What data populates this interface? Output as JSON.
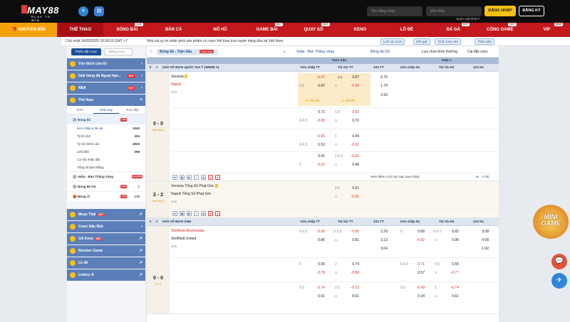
{
  "header": {
    "logo": "MAY88",
    "logo_sub": "PLAY TO WIN",
    "username_placeholder": "Tên đăng nhập",
    "password_placeholder": "Mật khẩu",
    "forgot": "Quên mật khẩu?",
    "login": "ĐĂNG NHẬP",
    "register": "ĐĂNG KÝ",
    "colors": {
      "nav": "#c3181d",
      "accent": "#f5c014",
      "blue": "#1c4f96"
    }
  },
  "nav": [
    {
      "label": "KHUYẾN MÃI",
      "badge": ""
    },
    {
      "label": "THỂ THAO",
      "badge": ""
    },
    {
      "label": "SÒNG BÀI",
      "badge": "LIVE"
    },
    {
      "label": "BẮN CÁ",
      "badge": ""
    },
    {
      "label": "NỔ HŨ",
      "badge": ""
    },
    {
      "label": "GAME BÀI",
      "badge": "HOT"
    },
    {
      "label": "QUAY SỐ",
      "badge": "HOT"
    },
    {
      "label": "KENO",
      "badge": ""
    },
    {
      "label": "LÔ ĐỀ",
      "badge": ""
    },
    {
      "label": "ĐÁ GÀ",
      "badge": "HOT"
    },
    {
      "label": "CỔNG GAME",
      "badge": "HOT"
    },
    {
      "label": "VIP",
      "badge": "NEW"
    }
  ],
  "subbar": {
    "clock": "Chủ nhật 16/03/2025 19:39:53 GMT +7",
    "ticker": "Nhà cái uy tín phân phối sản phẩm cá cược thể thao trực tuyến hàng đầu tại Việt Nam.",
    "btn1": "Lịch sử cược",
    "btn2": "Kết quả",
    "btn3": "Tỷ lệ cược MA",
    "btn4": "Thảo luận"
  },
  "left": {
    "tab_a": "Phiếu đặt cược",
    "tab_b": "Đặng cược",
    "heads": [
      {
        "label": "Yêu thích của tôi",
        "tag": ""
      },
      {
        "label": "Giải bóng đá Ngoại hạn...",
        "tag": "HOT"
      },
      {
        "label": "NBA",
        "tag": "HOT"
      },
      {
        "label": "Thể thao",
        "tag": ""
      }
    ],
    "subtabs": [
      "Sớm",
      "Hôm nay",
      "Trực tiếp"
    ],
    "rows": [
      {
        "label": "Bóng đá",
        "n": "",
        "red": "LIVE"
      },
      {
        "label": "Kèo chấp & tài xỉu",
        "n": "1540",
        "red": ""
      },
      {
        "label": "Tỷ lệ 1X2",
        "n": "404",
        "red": ""
      },
      {
        "label": "Tỷ số chính xác",
        "n": "4926",
        "red": ""
      },
      {
        "label": "Lẻ/Chẵn",
        "n": "398",
        "red": ""
      },
      {
        "label": "Cơ hội nhân đôi",
        "n": "",
        "red": ""
      },
      {
        "label": "Tổng số bàn thắng",
        "n": "",
        "red": ""
      }
    ],
    "mains": [
      {
        "label": "Volta - Bàn Thắng Vàng",
        "n": "",
        "red": "GOLDEN"
      },
      {
        "label": "Bóng đá GS",
        "n": "7",
        "red": "LIVE"
      },
      {
        "label": "Bóng rổ",
        "n": "170",
        "red": "LIVE"
      }
    ],
    "bottom": [
      "Muay Thái",
      "Cược Đặc Biệt",
      "GS Keno",
      "Number Game",
      "Lô đề",
      "Lottery A"
    ],
    "bottom_tag": "MỚI"
  },
  "mid": {
    "filter_sport": "Bóng đá - Trận đấu",
    "filter_live": "Trực tiếp",
    "filter_volta": "Volta - Bàn Thắng Vàng",
    "filter_gs": "Bóng đá GS",
    "filter_sort": "Lựa chọn bình thường",
    "filter_settings": "Cài đặt cược",
    "full": "Toàn trận",
    "half": "Hiệp 1",
    "cols": [
      "Kèo chấp TT",
      "Tài Xỉu TT",
      "1X2 TT",
      "Kèo chấp H1",
      "Tài Xỉu H1",
      "1X2 H1"
    ],
    "league1": "GIẢI VÔ ĐỊCH QUỐC GIA Ý (SERIE A)",
    "league2": "GIẢI VÔ ĐỊCH ANH",
    "m1": {
      "home": "Venezia",
      "away": "Napoli",
      "draw": "Hòa",
      "score": "0 - 0",
      "time": "Hết hiệp 1",
      "r1": [
        "-0.97",
        "1.5",
        "0.87",
        "6.75"
      ],
      "r2": [
        "0.5",
        "0.87",
        "u",
        "-0.99",
        "1.79"
      ],
      "r3": "2.63",
      "best": "Giá tốt",
      "b1": [
        "0.72",
        "1.5",
        "-0.82"
      ],
      "b2": [
        "0-0.5",
        "-0.83",
        "u",
        "0.70"
      ],
      "c1": [
        "-0.65",
        "1",
        "0.49"
      ],
      "c2": [
        "0-0.5",
        "0.53",
        "u",
        "-0.61"
      ],
      "d1": [
        "0.41",
        "1.5-2",
        "-0.60"
      ],
      "d2": [
        "1",
        "-0.52",
        "u",
        "0.48"
      ],
      "more": "Xem thêm (+3) các loại cược khác",
      "plus": "(+29)"
    },
    "m2": {
      "home": "Venezia Tổng Số Phạt Góc",
      "away": "Napoli Tổng Số Phạt Góc",
      "draw": "Hòa",
      "score": "2 - 2",
      "time": "Hết hiệp 1",
      "r1": [
        "8.5",
        "0.61"
      ],
      "r2": [
        "u",
        "-0.95"
      ]
    },
    "m3": {
      "home": "Sheffield Wednesday",
      "away": "Sheffield United",
      "draw": "Hòa",
      "score": "0 - 0",
      "time": "1H 9'",
      "r1": [
        "0-0.5",
        "-0.99",
        "2-2.5",
        "-0.95",
        "2.29",
        "0",
        "0.68",
        "0.5-1",
        "0.82",
        "3.08"
      ],
      "r2": [
        "0.86",
        "u",
        "0.81",
        "3.13",
        "-0.82",
        "u",
        "0.96",
        "4.08"
      ],
      "r3": [
        "3.04",
        "1.92"
      ],
      "b1": [
        "0",
        "0.65",
        "2",
        "0.74",
        "0-0.5",
        "-0.71",
        "0.5",
        "0.55"
      ],
      "b2": [
        "-0.78",
        "u",
        "-0.88",
        "0.57",
        "u",
        "-0.77"
      ],
      "c1": [
        "0.5",
        "-0.74",
        "2.5",
        "-0.73",
        "0.5",
        "-0.49",
        "1",
        "-0.74"
      ],
      "c2": [
        "0.61",
        "u",
        "0.61",
        "0.34",
        "u",
        "0.61"
      ]
    }
  },
  "widget": {
    "mini": "MINI",
    "game": "GAME"
  }
}
